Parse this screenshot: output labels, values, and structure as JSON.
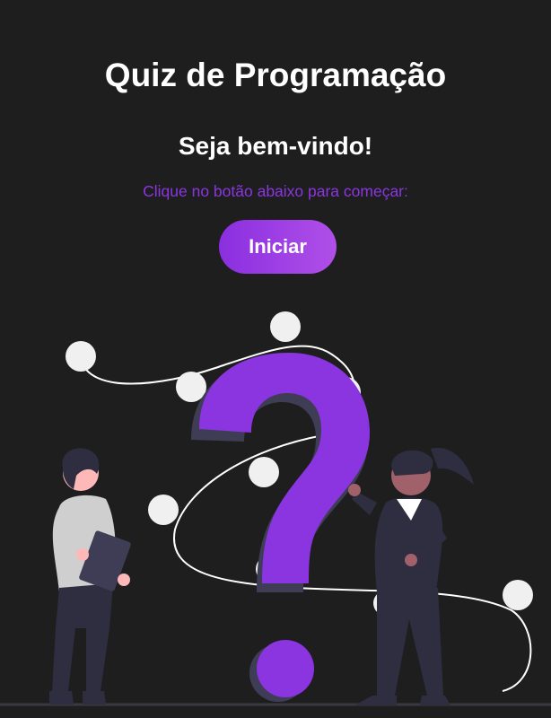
{
  "app": {
    "title": "Quiz de Programação"
  },
  "welcome": {
    "heading": "Seja bem-vindo!",
    "instruction": "Clique no botão abaixo para começar:",
    "start_label": "Iniciar"
  },
  "colors": {
    "background": "#1f1e1f",
    "accent": "#8a35e0",
    "button_gradient_start": "#8a2fe0",
    "button_gradient_end": "#b04fe8",
    "text": "#ffffff"
  },
  "illustration": {
    "subject": "question-mark-with-two-people"
  }
}
